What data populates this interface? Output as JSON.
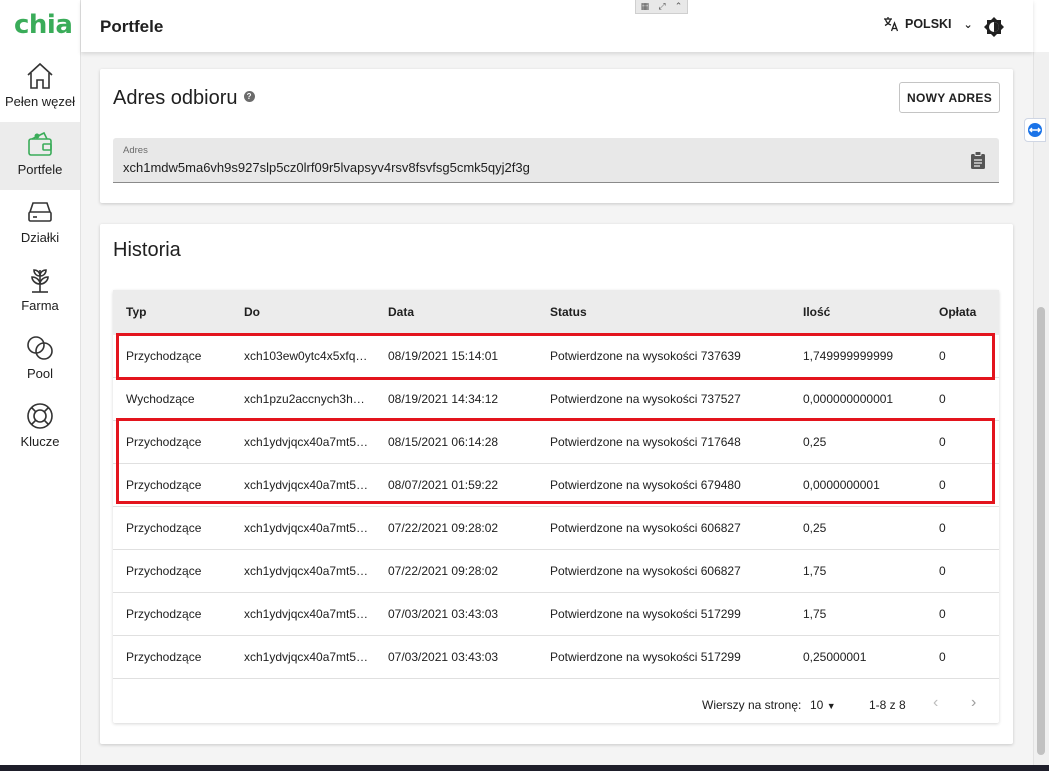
{
  "app": {
    "logo": "chia",
    "page_title": "Portfele"
  },
  "topbar": {
    "language": "POLSKI"
  },
  "sidebar": {
    "items": [
      {
        "label": "Pełen węzeł",
        "icon": "home-icon"
      },
      {
        "label": "Portfele",
        "icon": "wallet-icon",
        "active": true
      },
      {
        "label": "Działki",
        "icon": "storage-icon"
      },
      {
        "label": "Farma",
        "icon": "sprout-icon"
      },
      {
        "label": "Pool",
        "icon": "pool-icon"
      },
      {
        "label": "Klucze",
        "icon": "lifebuoy-icon"
      }
    ]
  },
  "receive": {
    "title": "Adres odbioru",
    "new_address_button": "NOWY ADRES",
    "field_label": "Adres",
    "address": "xch1mdw5ma6vh9s927slp5cz0lrf09r5lvapsyv4rsv8fsvfsg5cmk5qyj2f3g"
  },
  "history": {
    "title": "Historia",
    "columns": [
      "Typ",
      "Do",
      "Data",
      "Status",
      "Ilość",
      "Opłata"
    ],
    "rows": [
      {
        "typ": "Przychodzące",
        "do": "xch103ew0ytc4x5xfq…",
        "data": "08/19/2021 15:14:01",
        "status": "Potwierdzone na wysokości 737639",
        "ilosc": "1,749999999999",
        "oplata": "0"
      },
      {
        "typ": "Wychodzące",
        "do": "xch1pzu2accnych3h…",
        "data": "08/19/2021 14:34:12",
        "status": "Potwierdzone na wysokości 737527",
        "ilosc": "0,000000000001",
        "oplata": "0"
      },
      {
        "typ": "Przychodzące",
        "do": "xch1ydvjqcx40a7mt5…",
        "data": "08/15/2021 06:14:28",
        "status": "Potwierdzone na wysokości 717648",
        "ilosc": "0,25",
        "oplata": "0"
      },
      {
        "typ": "Przychodzące",
        "do": "xch1ydvjqcx40a7mt5…",
        "data": "08/07/2021 01:59:22",
        "status": "Potwierdzone na wysokości 679480",
        "ilosc": "0,0000000001",
        "oplata": "0"
      },
      {
        "typ": "Przychodzące",
        "do": "xch1ydvjqcx40a7mt5…",
        "data": "07/22/2021 09:28:02",
        "status": "Potwierdzone na wysokości 606827",
        "ilosc": "0,25",
        "oplata": "0"
      },
      {
        "typ": "Przychodzące",
        "do": "xch1ydvjqcx40a7mt5…",
        "data": "07/22/2021 09:28:02",
        "status": "Potwierdzone na wysokości 606827",
        "ilosc": "1,75",
        "oplata": "0"
      },
      {
        "typ": "Przychodzące",
        "do": "xch1ydvjqcx40a7mt5…",
        "data": "07/03/2021 03:43:03",
        "status": "Potwierdzone na wysokości 517299",
        "ilosc": "1,75",
        "oplata": "0"
      },
      {
        "typ": "Przychodzące",
        "do": "xch1ydvjqcx40a7mt5…",
        "data": "07/03/2021 03:43:03",
        "status": "Potwierdzone na wysokości 517299",
        "ilosc": "0,25000001",
        "oplata": "0"
      }
    ],
    "pagination": {
      "rows_per_page_label": "Wierszy na stronę:",
      "rows_per_page": "10",
      "range": "1-8 z 8"
    }
  },
  "colors": {
    "brand": "#3aac59",
    "highlight": "#e3141d",
    "header_bg": "#ececec"
  }
}
